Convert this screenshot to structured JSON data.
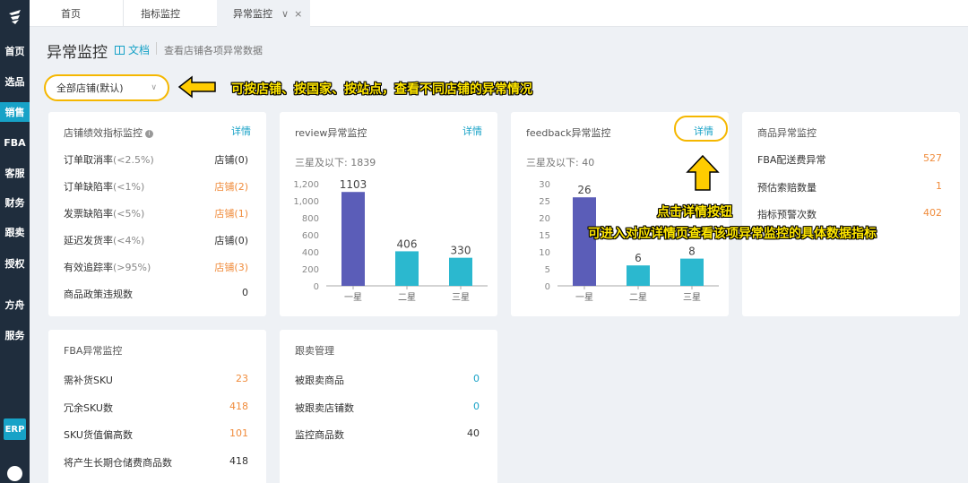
{
  "nav": {
    "items": [
      "首页",
      "选品",
      "销售",
      "FBA",
      "客服",
      "财务",
      "跟卖",
      "授权",
      "方舟",
      "服务"
    ],
    "active_index": 2,
    "erp": "ERP"
  },
  "tabs": [
    "首页",
    "指标监控",
    "异常监控"
  ],
  "header": {
    "title": "异常监控",
    "doc_link": "文档",
    "subtitle": "查看店铺各项异常数据"
  },
  "store_select": {
    "value": "全部店铺(默认)"
  },
  "annotations": {
    "select_hint": "可按店铺、按国家、按站点，查看不同店铺的异常情况",
    "detail_hint_1": "点击详情按钮",
    "detail_hint_2": "可进入对应详情页查看该项异常监控的具体数据指标"
  },
  "cards": {
    "store_perf": {
      "title": "店铺绩效指标监控",
      "link": "详情",
      "rows": [
        {
          "label": "订单取消率",
          "sub": "(<2.5%)",
          "value": "店铺(0)",
          "color": "#333333"
        },
        {
          "label": "订单缺陷率",
          "sub": "(<1%)",
          "value": "店铺(2)",
          "color": "#f08c3c"
        },
        {
          "label": "发票缺陷率",
          "sub": "(<5%)",
          "value": "店铺(1)",
          "color": "#f08c3c"
        },
        {
          "label": "延迟发货率",
          "sub": "(<4%)",
          "value": "店铺(0)",
          "color": "#333333"
        },
        {
          "label": "有效追踪率",
          "sub": "(>95%)",
          "value": "店铺(3)",
          "color": "#f08c3c"
        },
        {
          "label": "商品政策违规数",
          "sub": "",
          "value": "0",
          "color": "#333333"
        }
      ]
    },
    "review": {
      "title": "review异常监控",
      "link": "详情",
      "subtitle": "三星及以下: 1839"
    },
    "feedback": {
      "title": "feedback异常监控",
      "link": "详情",
      "subtitle": "三星及以下: 40"
    },
    "product": {
      "title": "商品异常监控",
      "rows": [
        {
          "label": "FBA配送费异常",
          "value": "527"
        },
        {
          "label": "预估索赔数量",
          "value": "1"
        },
        {
          "label": "指标预警次数",
          "value": "402"
        }
      ]
    },
    "fba": {
      "title": "FBA异常监控",
      "rows": [
        {
          "label": "需补货SKU",
          "value": "23",
          "color": "#f08c3c"
        },
        {
          "label": "冗余SKU数",
          "value": "418",
          "color": "#f08c3c"
        },
        {
          "label": "SKU货值偏高数",
          "value": "101",
          "color": "#f08c3c"
        },
        {
          "label": "将产生长期仓储费商品数",
          "value": "418",
          "color": "#333333"
        }
      ]
    },
    "follow": {
      "title": "跟卖管理",
      "rows": [
        {
          "label": "被跟卖商品",
          "value": "0",
          "color": "#17a2c7"
        },
        {
          "label": "被跟卖店铺数",
          "value": "0",
          "color": "#17a2c7"
        },
        {
          "label": "监控商品数",
          "value": "40",
          "color": "#333333"
        }
      ]
    }
  },
  "chart_data": [
    {
      "type": "bar",
      "categories": [
        "一星",
        "二星",
        "三星"
      ],
      "values": [
        1103,
        406,
        330
      ],
      "ylim": [
        0,
        1200
      ],
      "yticks": [
        "0",
        "200",
        "400",
        "600",
        "800",
        "1,000",
        "1,200"
      ],
      "colors": [
        "#5b5db8",
        "#2bb8cf",
        "#2bb8cf"
      ]
    },
    {
      "type": "bar",
      "categories": [
        "一星",
        "二星",
        "三星"
      ],
      "values": [
        26,
        6,
        8
      ],
      "ylim": [
        0,
        30
      ],
      "yticks": [
        "0",
        "5",
        "10",
        "15",
        "20",
        "25",
        "30"
      ],
      "colors": [
        "#5b5db8",
        "#2bb8cf",
        "#2bb8cf"
      ]
    }
  ],
  "colors": {
    "accent": "#17a2c7",
    "warning": "#f08c3c",
    "highlight": "#f5b700",
    "nav_bg": "#1f2d3d"
  }
}
